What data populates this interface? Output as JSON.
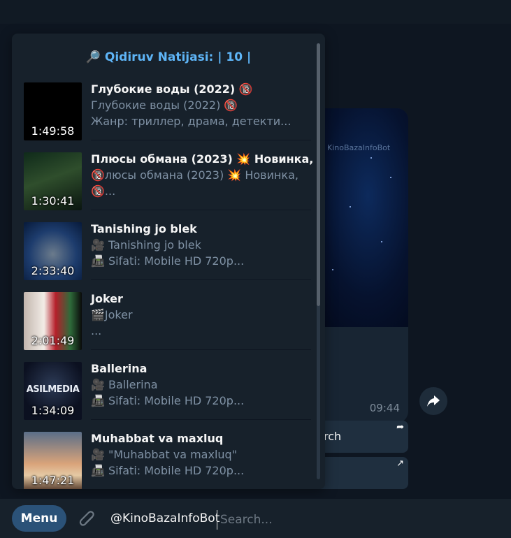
{
  "popup": {
    "title": "🔎 Qidiruv Natijasi: | 10 |",
    "results": [
      {
        "title": "Глубокие воды (2022) 🔞",
        "line1": "Глубокие воды (2022) 🔞",
        "line2": "Жанр: триллер, драма, детекти...",
        "duration": "1:49:58"
      },
      {
        "title": "Плюсы обмана (2023) 💥 Новинка,",
        "line1": "🔞люсы обмана (2023) 💥 Новинка,",
        "line2": "🔞...",
        "duration": "1:30:41"
      },
      {
        "title": "Tanishing jo blek",
        "line1": "🎥 Tanishing jo blek",
        "line2": "📠 Sifati: Mobile HD 720p...",
        "duration": "2:33:40"
      },
      {
        "title": "Joker",
        "line1": "🎬Joker",
        "line2": "...",
        "duration": "2:01:49"
      },
      {
        "title": "Ballerina",
        "line1": "🎥 Ballerina",
        "line2": "📠 Sifati: Mobile HD 720p...",
        "duration": "1:34:09",
        "thumb_text": "ASILMEDIA"
      },
      {
        "title": "Muhabbat va maxluq",
        "line1": "🎥 \"Muhabbat va maxluq\"",
        "line2": "📠 Sifati: Mobile HD 720p...",
        "duration": "1:47:21"
      }
    ]
  },
  "message": {
    "watermark": "KinoBazaInfoBot",
    "time": "09:44",
    "buttons": [
      {
        "label": "rch",
        "icon": "share-arrow-icon"
      },
      {
        "label": "",
        "icon": "external-link-icon"
      }
    ]
  },
  "input": {
    "menu_label": "Menu",
    "prefix": "@KinoBazaInfoBot",
    "placeholder": "Search..."
  },
  "colors": {
    "accent": "#5eb5f7",
    "menu_button": "#2b5278",
    "background": "#0e1621",
    "panel": "#17212b"
  }
}
